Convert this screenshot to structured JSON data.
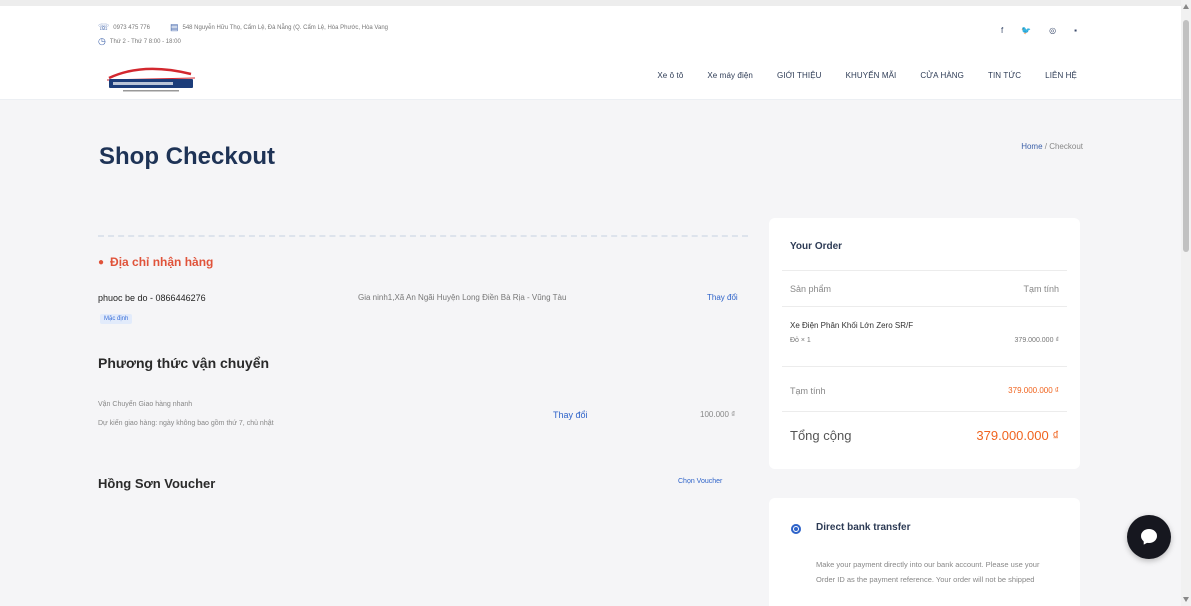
{
  "topbar": {
    "phone": "0973 475 776",
    "address": "548 Nguyễn Hữu Thọ, Cẩm Lệ, Đà Nẵng (Q. Cẩm Lệ, Hòa Phước, Hòa Vang",
    "hours": "Thứ 2 - Thứ 7 8:00 - 18:00",
    "social": [
      {
        "icon": "facebook-icon",
        "glyph": "f"
      },
      {
        "icon": "twitter-icon",
        "glyph": "🐦"
      },
      {
        "icon": "instagram-icon",
        "glyph": "◎"
      },
      {
        "icon": "linkedin-icon",
        "glyph": "▪"
      }
    ]
  },
  "nav": {
    "items": [
      "Xe ô tô",
      "Xe máy điện",
      "GIỚI THIỆU",
      "KHUYẾN MÃI",
      "CỬA HÀNG",
      "TIN TỨC",
      "LIÊN HỆ"
    ]
  },
  "page": {
    "title": "Shop Checkout",
    "breadcrumb_home": "Home",
    "breadcrumb_sep": " / ",
    "breadcrumb_current": "Checkout"
  },
  "address": {
    "heading": "Địa chỉ nhận hàng",
    "name_phone": "phuoc be do - 0866446276",
    "tag": "Mặc định",
    "full_address": "Gia ninh1,Xã An Ngãi Huyện Long Điền Bà Rịa - Vũng Tàu",
    "change_label": "Thay đổi"
  },
  "shipping": {
    "heading": "Phương thức vận chuyển",
    "method": "Vận Chuyển Giao hàng nhanh",
    "estimate": "Dự kiến giao hàng: ngày không bao gồm thứ 7, chủ nhật",
    "change_label": "Thay đổi",
    "price": "100.000 ₫"
  },
  "voucher": {
    "heading": "Hồng Sơn Voucher",
    "link": "Chọn Voucher"
  },
  "order": {
    "heading": "Your Order",
    "col_product": "Sản phẩm",
    "col_subtotal": "Tạm tính",
    "product_name": "Xe Điện Phân Khối Lớn Zero SR/F",
    "product_qty": "Đỏ × 1",
    "product_price": "379.000.000 ₫",
    "subtotal_label": "Tạm tính",
    "subtotal_value": "379.000.000 ₫",
    "total_label": "Tổng cộng",
    "total_value": "379.000.000 ₫"
  },
  "payment": {
    "method": "Direct bank transfer",
    "description": "Make your payment directly into our bank account. Please use your Order ID as the payment reference. Your order will not be shipped"
  },
  "colors": {
    "title": "#1e3356",
    "accent_blue": "#2e63c9",
    "accent_orange": "#f0641f",
    "address_red": "#e0533a"
  }
}
